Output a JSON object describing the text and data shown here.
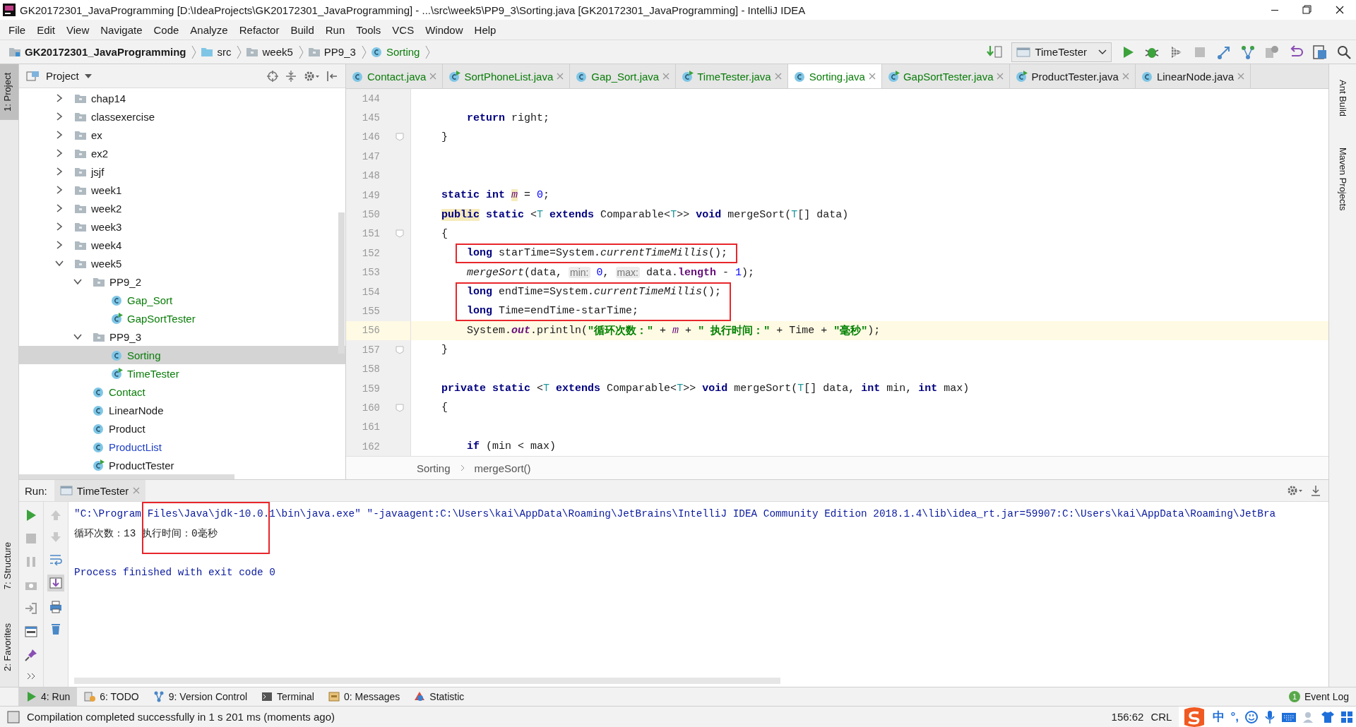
{
  "window": {
    "title": "GK20172301_JavaProgramming [D:\\IdeaProjects\\GK20172301_JavaProgramming] - ...\\src\\week5\\PP9_3\\Sorting.java [GK20172301_JavaProgramming] - IntelliJ IDEA"
  },
  "menu": [
    "File",
    "Edit",
    "View",
    "Navigate",
    "Code",
    "Analyze",
    "Refactor",
    "Build",
    "Run",
    "Tools",
    "VCS",
    "Window",
    "Help"
  ],
  "nav": {
    "crumbs": [
      {
        "label": "GK20172301_JavaProgramming",
        "kind": "module",
        "color": "#1a1a1a"
      },
      {
        "label": "src",
        "kind": "source",
        "color": "#1a1a1a"
      },
      {
        "label": "week5",
        "kind": "folder",
        "color": "#1a1a1a"
      },
      {
        "label": "PP9_3",
        "kind": "folder",
        "color": "#1a1a1a"
      },
      {
        "label": "Sorting",
        "kind": "class",
        "color": "#0a7d0a"
      }
    ],
    "run_config": "TimeTester"
  },
  "left_stripes": [
    {
      "label": "1: Project",
      "selected": true,
      "kind": "top"
    },
    {
      "label": "7: Structure",
      "selected": false,
      "kind": "bottom"
    },
    {
      "label": "2: Favorites",
      "selected": false,
      "kind": "bottom"
    }
  ],
  "right_stripes": [
    "Ant Build",
    "Maven Projects"
  ],
  "project": {
    "title": "Project",
    "tree": [
      {
        "label": "chap14",
        "kind": "folder",
        "expanded": false,
        "selected": false,
        "color": "#1a1a1a"
      },
      {
        "label": "classexercise",
        "kind": "folder",
        "expanded": false,
        "selected": false,
        "color": "#1a1a1a"
      },
      {
        "label": "ex",
        "kind": "folder",
        "expanded": false,
        "selected": false,
        "color": "#1a1a1a"
      },
      {
        "label": "ex2",
        "kind": "folder",
        "expanded": false,
        "selected": false,
        "color": "#1a1a1a"
      },
      {
        "label": "jsjf",
        "kind": "folder",
        "expanded": false,
        "selected": false,
        "color": "#1a1a1a"
      },
      {
        "label": "week1",
        "kind": "folder",
        "expanded": false,
        "selected": false,
        "color": "#1a1a1a"
      },
      {
        "label": "week2",
        "kind": "folder",
        "expanded": false,
        "selected": false,
        "color": "#1a1a1a"
      },
      {
        "label": "week3",
        "kind": "folder",
        "expanded": false,
        "selected": false,
        "color": "#1a1a1a"
      },
      {
        "label": "week4",
        "kind": "folder",
        "expanded": false,
        "selected": false,
        "color": "#1a1a1a"
      },
      {
        "label": "week5",
        "kind": "folder",
        "expanded": true,
        "selected": false,
        "color": "#1a1a1a",
        "children": [
          {
            "label": "PP9_2",
            "kind": "folder",
            "expanded": true,
            "selected": false,
            "color": "#1a1a1a",
            "children": [
              {
                "label": "Gap_Sort",
                "kind": "class",
                "selected": false,
                "color": "#0a7d0a"
              },
              {
                "label": "GapSortTester",
                "kind": "runnable",
                "selected": false,
                "color": "#0a7d0a"
              }
            ]
          },
          {
            "label": "PP9_3",
            "kind": "folder",
            "expanded": true,
            "selected": false,
            "color": "#1a1a1a",
            "children": [
              {
                "label": "Sorting",
                "kind": "class",
                "selected": true,
                "color": "#0a7d0a"
              },
              {
                "label": "TimeTester",
                "kind": "runnable",
                "selected": false,
                "color": "#0a7d0a"
              }
            ]
          },
          {
            "label": "Contact",
            "kind": "class",
            "selected": false,
            "color": "#0a7d0a"
          },
          {
            "label": "LinearNode",
            "kind": "class",
            "selected": false,
            "color": "#1a1a1a"
          },
          {
            "label": "Product",
            "kind": "class",
            "selected": false,
            "color": "#1a1a1a"
          },
          {
            "label": "ProductList",
            "kind": "class",
            "selected": false,
            "color": "#1f3fc4"
          },
          {
            "label": "ProductTester",
            "kind": "runnable",
            "selected": false,
            "color": "#1a1a1a"
          }
        ]
      }
    ]
  },
  "tabs": [
    {
      "label": "Contact.java",
      "kind": "class",
      "selected": false,
      "color": "#0a7d0a"
    },
    {
      "label": "SortPhoneList.java",
      "kind": "runnable",
      "selected": false,
      "color": "#0a7d0a"
    },
    {
      "label": "Gap_Sort.java",
      "kind": "class",
      "selected": false,
      "color": "#0a7d0a"
    },
    {
      "label": "TimeTester.java",
      "kind": "runnable",
      "selected": false,
      "color": "#0a7d0a"
    },
    {
      "label": "Sorting.java",
      "kind": "class",
      "selected": true,
      "color": "#0a7d0a"
    },
    {
      "label": "GapSortTester.java",
      "kind": "runnable",
      "selected": false,
      "color": "#0a7d0a"
    },
    {
      "label": "ProductTester.java",
      "kind": "runnable",
      "selected": false,
      "color": "#1a1a1a"
    },
    {
      "label": "LinearNode.java",
      "kind": "class",
      "selected": false,
      "color": "#1a1a1a"
    }
  ],
  "editor": {
    "lines": [
      {
        "number": "144",
        "fold": false,
        "current": false,
        "boxed": false
      },
      {
        "number": "145",
        "fold": false,
        "current": false,
        "boxed": false,
        "tokens": [
          {
            "t": "        return",
            "kind": "kw"
          },
          {
            "t": " right;",
            "kind": "plain"
          }
        ]
      },
      {
        "number": "146",
        "fold": true,
        "current": false,
        "boxed": false,
        "tokens": [
          {
            "t": "    }",
            "kind": "plain"
          }
        ]
      },
      {
        "number": "147",
        "fold": false,
        "current": false,
        "boxed": false
      },
      {
        "number": "148",
        "fold": false,
        "current": false,
        "boxed": false
      },
      {
        "number": "149",
        "fold": false,
        "current": false,
        "boxed": false,
        "tokens": [
          {
            "t": "    static int ",
            "kind": "kw"
          },
          {
            "t": "m",
            "kind": "field",
            "hl": true
          },
          {
            "t": " = ",
            "kind": "plain"
          },
          {
            "t": "0",
            "kind": "num"
          },
          {
            "t": ";",
            "kind": "plain"
          }
        ]
      },
      {
        "number": "150",
        "fold": false,
        "current": false,
        "boxed": false,
        "tokens": [
          {
            "t": "    public",
            "kind": "kw",
            "hl": true
          },
          {
            "t": " static",
            "kind": "kw"
          },
          {
            "t": " <",
            "kind": "plain"
          },
          {
            "t": "T",
            "kind": "tp"
          },
          {
            "t": " extends",
            "kind": "kw"
          },
          {
            "t": " Comparable<",
            "kind": "plain"
          },
          {
            "t": "T",
            "kind": "tp"
          },
          {
            "t": ">> ",
            "kind": "plain"
          },
          {
            "t": "void",
            "kind": "kw"
          },
          {
            "t": " mergeSort(",
            "kind": "plain"
          },
          {
            "t": "T",
            "kind": "tp"
          },
          {
            "t": "[] data)",
            "kind": "plain"
          }
        ]
      },
      {
        "number": "151",
        "fold": true,
        "current": false,
        "boxed": false,
        "tokens": [
          {
            "t": "    {",
            "kind": "plain"
          }
        ]
      },
      {
        "number": "152",
        "fold": false,
        "current": false,
        "boxed": true,
        "tokens": [
          {
            "t": "        long",
            "kind": "kw"
          },
          {
            "t": " starTime=System.",
            "kind": "plain"
          },
          {
            "t": "currentTimeMillis",
            "kind": "italic"
          },
          {
            "t": "();",
            "kind": "plain"
          }
        ]
      },
      {
        "number": "153",
        "fold": false,
        "current": false,
        "boxed": false,
        "tokens": [
          {
            "t": "        mergeSort",
            "kind": "italic"
          },
          {
            "t": "(data, ",
            "kind": "plain"
          },
          {
            "t": "min:",
            "kind": "hint"
          },
          {
            "t": " 0",
            "kind": "num"
          },
          {
            "t": ", ",
            "kind": "plain"
          },
          {
            "t": "max:",
            "kind": "hint"
          },
          {
            "t": " data.",
            "kind": "plain"
          },
          {
            "t": "length",
            "kind": "fieldb"
          },
          {
            "t": " - ",
            "kind": "plain"
          },
          {
            "t": "1",
            "kind": "num"
          },
          {
            "t": ");",
            "kind": "plain"
          }
        ]
      },
      {
        "number": "154",
        "fold": false,
        "current": false,
        "boxed": true,
        "tokens": [
          {
            "t": "        long",
            "kind": "kw"
          },
          {
            "t": " endTime=System.",
            "kind": "plain"
          },
          {
            "t": "currentTimeMillis",
            "kind": "italic"
          },
          {
            "t": "();",
            "kind": "plain"
          }
        ]
      },
      {
        "number": "155",
        "fold": false,
        "current": false,
        "boxed": true,
        "tokens": [
          {
            "t": "        long",
            "kind": "kw"
          },
          {
            "t": " Time=endTime-starTime;",
            "kind": "plain"
          }
        ]
      },
      {
        "number": "156",
        "fold": false,
        "current": true,
        "boxed": false,
        "tokens": [
          {
            "t": "        System.",
            "kind": "plain"
          },
          {
            "t": "out",
            "kind": "out"
          },
          {
            "t": ".println(",
            "kind": "plain"
          },
          {
            "t": "\"循环次数：\"",
            "kind": "str"
          },
          {
            "t": " + ",
            "kind": "plain"
          },
          {
            "t": "m",
            "kind": "field"
          },
          {
            "t": " + ",
            "kind": "plain"
          },
          {
            "t": "\" 执行时间：\"",
            "kind": "str"
          },
          {
            "t": " + Time + ",
            "kind": "plain"
          },
          {
            "t": "\"毫秒\"",
            "kind": "str"
          },
          {
            "t": ");",
            "kind": "plain"
          }
        ]
      },
      {
        "number": "157",
        "fold": true,
        "current": false,
        "boxed": false,
        "tokens": [
          {
            "t": "    }",
            "kind": "plain"
          }
        ]
      },
      {
        "number": "158",
        "fold": false,
        "current": false,
        "boxed": false
      },
      {
        "number": "159",
        "fold": false,
        "current": false,
        "boxed": false,
        "tokens": [
          {
            "t": "    private static",
            "kind": "kw"
          },
          {
            "t": " <",
            "kind": "plain"
          },
          {
            "t": "T",
            "kind": "tp"
          },
          {
            "t": " extends",
            "kind": "kw"
          },
          {
            "t": " Comparable<",
            "kind": "plain"
          },
          {
            "t": "T",
            "kind": "tp"
          },
          {
            "t": ">> ",
            "kind": "plain"
          },
          {
            "t": "void",
            "kind": "kw"
          },
          {
            "t": " mergeSort(",
            "kind": "plain"
          },
          {
            "t": "T",
            "kind": "tp"
          },
          {
            "t": "[] data, ",
            "kind": "plain"
          },
          {
            "t": "int",
            "kind": "kw"
          },
          {
            "t": " min, ",
            "kind": "plain"
          },
          {
            "t": "int",
            "kind": "kw"
          },
          {
            "t": " max)",
            "kind": "plain"
          }
        ]
      },
      {
        "number": "160",
        "fold": true,
        "current": false,
        "boxed": false,
        "tokens": [
          {
            "t": "    {",
            "kind": "plain"
          }
        ]
      },
      {
        "number": "161",
        "fold": false,
        "current": false,
        "boxed": false
      },
      {
        "number": "162",
        "fold": false,
        "current": false,
        "boxed": false,
        "tokens": [
          {
            "t": "        if",
            "kind": "kw"
          },
          {
            "t": " (min < max)",
            "kind": "plain"
          }
        ]
      }
    ],
    "breadcrumb": [
      "Sorting",
      "mergeSort()"
    ]
  },
  "run": {
    "label": "Run:",
    "tab": "TimeTester",
    "red_box": true,
    "console": [
      {
        "kind": "system",
        "text": "\"C:\\Program Files\\Java\\jdk-10.0.1\\bin\\java.exe\" \"-javaagent:C:\\Users\\kai\\AppData\\Roaming\\JetBrains\\IntelliJ IDEA Community Edition 2018.1.4\\lib\\idea_rt.jar=59907:C:\\Users\\kai\\AppData\\Roaming\\JetBra"
      },
      {
        "kind": "stdout",
        "text": "循环次数：13 执行时间：0毫秒"
      },
      {
        "kind": "blank"
      },
      {
        "kind": "system",
        "text": "Process finished with exit code 0"
      }
    ]
  },
  "bottom_tabs": [
    {
      "label": "4: Run",
      "kind": "run",
      "selected": true
    },
    {
      "label": "6: TODO",
      "kind": "todo",
      "selected": false
    },
    {
      "label": "9: Version Control",
      "kind": "vcs",
      "selected": false
    },
    {
      "label": "Terminal",
      "kind": "terminal",
      "selected": false
    },
    {
      "label": "0: Messages",
      "kind": "messages",
      "selected": false
    },
    {
      "label": "Statistic",
      "kind": "statistic",
      "selected": false
    }
  ],
  "event_log": {
    "label": "Event Log",
    "count": "1"
  },
  "status": {
    "message": "Compilation completed successfully in 1 s 201 ms (moments ago)",
    "position": "156:62",
    "line_separator": "CRL"
  },
  "ime": {
    "labels": [
      "中",
      "°,"
    ]
  }
}
